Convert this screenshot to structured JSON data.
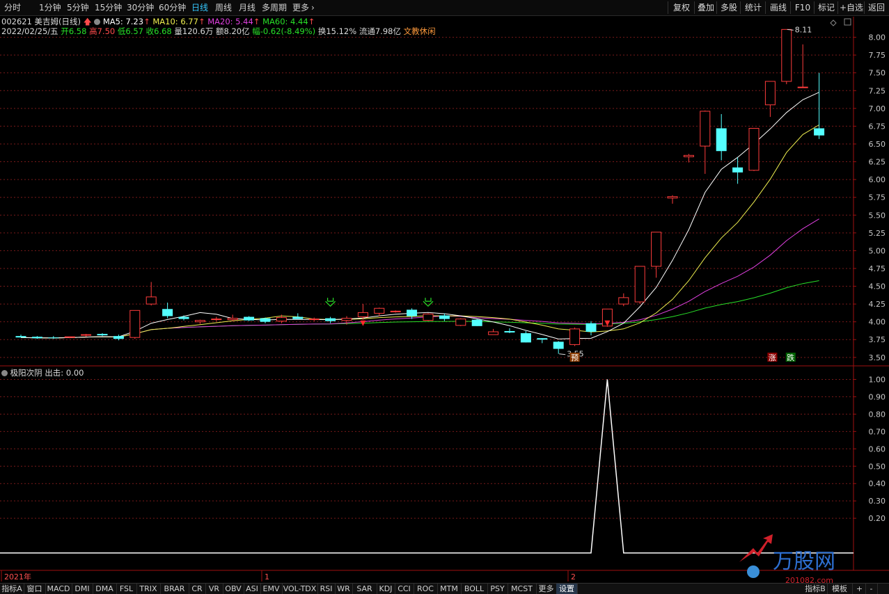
{
  "toolbar": {
    "period_tabs": [
      "分时",
      "1分钟",
      "5分钟",
      "15分钟",
      "30分钟",
      "60分钟",
      "日线",
      "周线",
      "月线",
      "多周期",
      "更多"
    ],
    "active_tab": "日线",
    "right_buttons": [
      "复权",
      "叠加",
      "多股",
      "统计",
      "画线",
      "F10",
      "标记",
      "+自选",
      "返回"
    ]
  },
  "stock": {
    "code_name": "002621 美吉姆(日线)",
    "ma": [
      {
        "label": "MA5: 7.23",
        "color": "#ffffff"
      },
      {
        "label": "MA10: 6.77",
        "color": "#f0f050"
      },
      {
        "label": "MA20: 5.44",
        "color": "#e040e0"
      },
      {
        "label": "MA60: 4.44",
        "color": "#28e028"
      }
    ],
    "date": "2022/02/25/五",
    "open": {
      "label": "开",
      "value": "6.58"
    },
    "high": {
      "label": "高",
      "value": "7.50"
    },
    "low": {
      "label": "低",
      "value": "6.57"
    },
    "close": {
      "label": "收",
      "value": "6.68"
    },
    "volume": {
      "label": "量",
      "value": "120.6万"
    },
    "amount": {
      "label": "额",
      "value": "8.20亿"
    },
    "change": {
      "label": "幅",
      "value": "-0.62(-8.49%)"
    },
    "turnover": {
      "label": "换",
      "value": "15.12%"
    },
    "float": {
      "label": "流通",
      "value": "7.98亿"
    },
    "sector": "文教休闲"
  },
  "indicator": {
    "name": "极阳次阴",
    "output": "出击: 0.00"
  },
  "chart_data": [
    {
      "type": "candlestick",
      "title": "",
      "y_ticks": [
        "8.00",
        "7.75",
        "7.50",
        "7.25",
        "7.00",
        "6.75",
        "6.50",
        "6.25",
        "6.00",
        "5.75",
        "5.50",
        "5.25",
        "5.00",
        "4.75",
        "4.50",
        "4.25",
        "4.00",
        "3.75",
        "3.50"
      ],
      "ylim": [
        3.42,
        8.25
      ],
      "x_labels": [
        "2021年",
        "1",
        "2"
      ],
      "annotations": {
        "high": "8.11",
        "low": "3.55"
      },
      "markers": [
        "预",
        "涨",
        "跌"
      ],
      "candles": [
        [
          3.8,
          3.82,
          3.78,
          3.78
        ],
        [
          3.79,
          3.8,
          3.76,
          3.77
        ],
        [
          3.78,
          3.8,
          3.76,
          3.77
        ],
        [
          3.78,
          3.79,
          3.77,
          3.79
        ],
        [
          3.81,
          3.83,
          3.79,
          3.82
        ],
        [
          3.83,
          3.84,
          3.8,
          3.81
        ],
        [
          3.8,
          3.82,
          3.74,
          3.76
        ],
        [
          3.78,
          4.16,
          3.76,
          4.16
        ],
        [
          4.25,
          4.56,
          4.23,
          4.35
        ],
        [
          4.18,
          4.27,
          4.05,
          4.08
        ],
        [
          4.07,
          4.09,
          4.02,
          4.04
        ],
        [
          4.0,
          4.03,
          3.97,
          4.02
        ],
        [
          4.03,
          4.07,
          4.01,
          4.04
        ],
        [
          4.03,
          4.1,
          4.01,
          4.05
        ],
        [
          4.07,
          4.08,
          4.01,
          4.02
        ],
        [
          4.05,
          4.06,
          3.98,
          4.0
        ],
        [
          4.01,
          4.1,
          3.98,
          4.06
        ],
        [
          4.07,
          4.12,
          4.04,
          4.04
        ],
        [
          4.03,
          4.06,
          4.01,
          4.04
        ],
        [
          4.05,
          4.07,
          3.98,
          4.01
        ],
        [
          4.02,
          4.08,
          3.96,
          4.05
        ],
        [
          4.07,
          4.25,
          4.03,
          4.13
        ],
        [
          4.12,
          4.2,
          4.08,
          4.19
        ],
        [
          4.14,
          4.16,
          4.13,
          4.15
        ],
        [
          4.17,
          4.19,
          4.04,
          4.08
        ],
        [
          4.02,
          4.12,
          4.01,
          4.11
        ],
        [
          4.09,
          4.12,
          4.01,
          4.04
        ],
        [
          3.95,
          4.05,
          3.94,
          4.04
        ],
        [
          4.03,
          4.04,
          3.94,
          3.94
        ],
        [
          3.82,
          3.9,
          3.82,
          3.86
        ],
        [
          3.87,
          3.91,
          3.84,
          3.85
        ],
        [
          3.84,
          3.87,
          3.71,
          3.71
        ],
        [
          3.77,
          3.77,
          3.7,
          3.75
        ],
        [
          3.72,
          3.73,
          3.55,
          3.62
        ],
        [
          3.68,
          3.92,
          3.66,
          3.9
        ],
        [
          3.98,
          4.01,
          3.81,
          3.86
        ],
        [
          3.94,
          4.18,
          3.93,
          4.18
        ],
        [
          4.25,
          4.4,
          4.22,
          4.34
        ],
        [
          4.28,
          4.78,
          4.25,
          4.78
        ],
        [
          4.78,
          5.26,
          4.62,
          5.26
        ],
        [
          5.74,
          5.78,
          5.66,
          5.76
        ],
        [
          6.32,
          6.36,
          6.24,
          6.34
        ],
        [
          6.47,
          6.97,
          6.08,
          6.96
        ],
        [
          6.72,
          6.92,
          6.27,
          6.4
        ],
        [
          6.17,
          6.31,
          5.94,
          6.1
        ],
        [
          6.13,
          6.72,
          6.12,
          6.72
        ],
        [
          7.05,
          7.38,
          6.88,
          7.38
        ],
        [
          7.38,
          8.11,
          7.34,
          8.11
        ],
        [
          7.3,
          7.9,
          7.29,
          7.3
        ],
        [
          6.72,
          7.5,
          6.57,
          6.62
        ]
      ]
    },
    {
      "type": "line",
      "title": "",
      "series": [
        {
          "name": "出击",
          "values": [
            0,
            0,
            0,
            0,
            0,
            0,
            0,
            0,
            0,
            0,
            0,
            0,
            0,
            0,
            0,
            0,
            0,
            0,
            0,
            0,
            0,
            0,
            0,
            0,
            0,
            0,
            0,
            0,
            0,
            0,
            0,
            0,
            0,
            0,
            0,
            0,
            1.0,
            0,
            0,
            0,
            0,
            0,
            0,
            0,
            0,
            0,
            0,
            0,
            0,
            0
          ]
        }
      ],
      "y_ticks": [
        "1.00",
        "0.90",
        "0.80",
        "0.70",
        "0.60",
        "0.50",
        "0.40",
        "0.30",
        "0.20"
      ],
      "ylim": [
        -0.1,
        1.07
      ]
    }
  ],
  "bottom_tabs": [
    "指标A",
    "窗口",
    "MACD",
    "DMI",
    "DMA",
    "FSL",
    "TRIX",
    "BRAR",
    "CR",
    "VR",
    "OBV",
    "ASI",
    "EMV",
    "VOL-TDX",
    "RSI",
    "WR",
    "SAR",
    "KDJ",
    "CCI",
    "ROC",
    "MTM",
    "BOLL",
    "PSY",
    "MCST",
    "更多",
    "设置"
  ],
  "bottom_right": [
    "指标B",
    "模板",
    "+",
    "-"
  ],
  "watermark": {
    "brand": "万股网",
    "site": "201082.com"
  },
  "colors": {
    "up": "#ff3c3c",
    "down": "#54ffff",
    "ma5": "#ffffff",
    "ma10": "#f0f050",
    "ma20": "#e040e0",
    "ma60": "#28e028",
    "grid": "#7a1a1a"
  }
}
